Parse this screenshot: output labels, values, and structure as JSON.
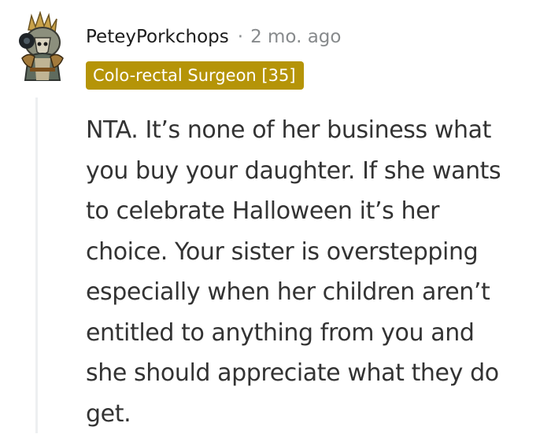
{
  "comment": {
    "username": "PeteyPorkchops",
    "separator": "·",
    "timestamp": "2 mo. ago",
    "flair": "Colo-rectal Surgeon [35]",
    "flair_color": "#b59408",
    "avatar_icon": "snoo-avatar-icon",
    "body_lines": [
      "NTA. It’s none of her business what",
      "you buy your daughter. If she wants",
      "to celebrate Halloween it’s her",
      "choice. Your sister is overstepping",
      "especially when her children aren’t",
      "entitled to anything from you and",
      "she should appreciate what they do",
      "get."
    ]
  }
}
